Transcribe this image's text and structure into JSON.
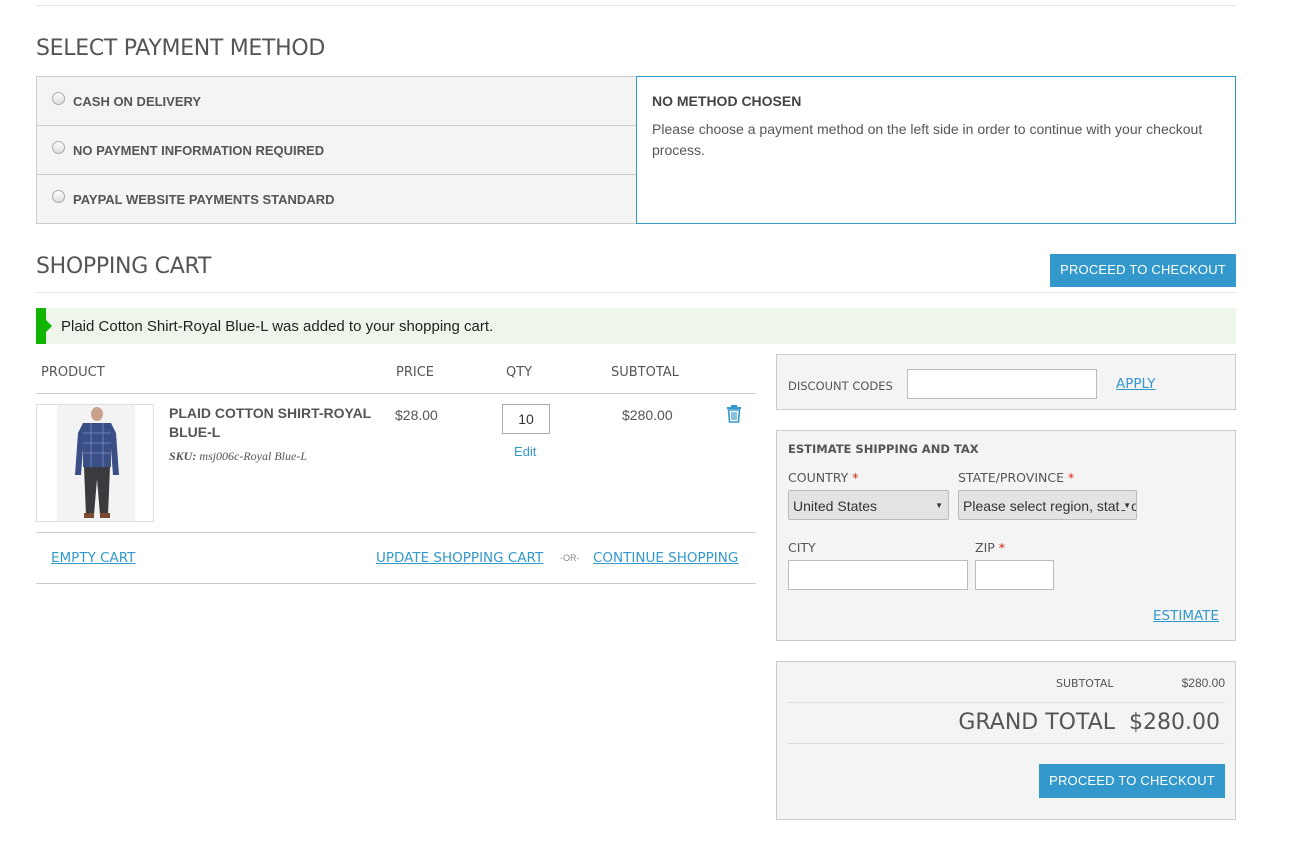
{
  "payment": {
    "title": "SELECT PAYMENT METHOD",
    "options": [
      {
        "label": "CASH ON DELIVERY"
      },
      {
        "label": "NO PAYMENT INFORMATION REQUIRED"
      },
      {
        "label": "PAYPAL WEBSITE PAYMENTS STANDARD"
      }
    ],
    "panel": {
      "heading": "NO METHOD CHOSEN",
      "text": "Please choose a payment method on the left side in order to continue with your checkout process."
    }
  },
  "cart": {
    "title": "SHOPPING CART",
    "proceed_label": "PROCEED TO CHECKOUT",
    "notice": "Plaid Cotton Shirt-Royal Blue-L was added to your shopping cart.",
    "columns": {
      "product": "PRODUCT",
      "price": "PRICE",
      "qty": "QTY",
      "subtotal": "SUBTOTAL"
    },
    "items": [
      {
        "name": "PLAID COTTON SHIRT-ROYAL BLUE-L",
        "sku_label": "SKU:",
        "sku": "msj006c-Royal Blue-L",
        "price": "$28.00",
        "qty": "10",
        "edit_label": "Edit",
        "subtotal": "$280.00"
      }
    ],
    "empty_label": "EMPTY CART",
    "update_label": "UPDATE SHOPPING CART",
    "or_label": "-OR-",
    "continue_label": "CONTINUE SHOPPING"
  },
  "discount": {
    "label": "DISCOUNT CODES",
    "value": "",
    "apply_label": "APPLY"
  },
  "shipping": {
    "title": "ESTIMATE SHIPPING AND TAX",
    "country_label": "COUNTRY",
    "country_value": "United States",
    "state_label": "STATE/PROVINCE",
    "state_value": "Please select region, state or province",
    "city_label": "CITY",
    "zip_label": "ZIP",
    "required_mark": "*",
    "estimate_label": "ESTIMATE"
  },
  "totals": {
    "subtotal_label": "SUBTOTAL",
    "subtotal_value": "$280.00",
    "grand_label": "GRAND TOTAL",
    "grand_value": "$280.00",
    "proceed_label": "PROCEED TO CHECKOUT"
  },
  "colors": {
    "accent": "#3399cc",
    "success": "#11b400",
    "required": "#dd2211"
  }
}
